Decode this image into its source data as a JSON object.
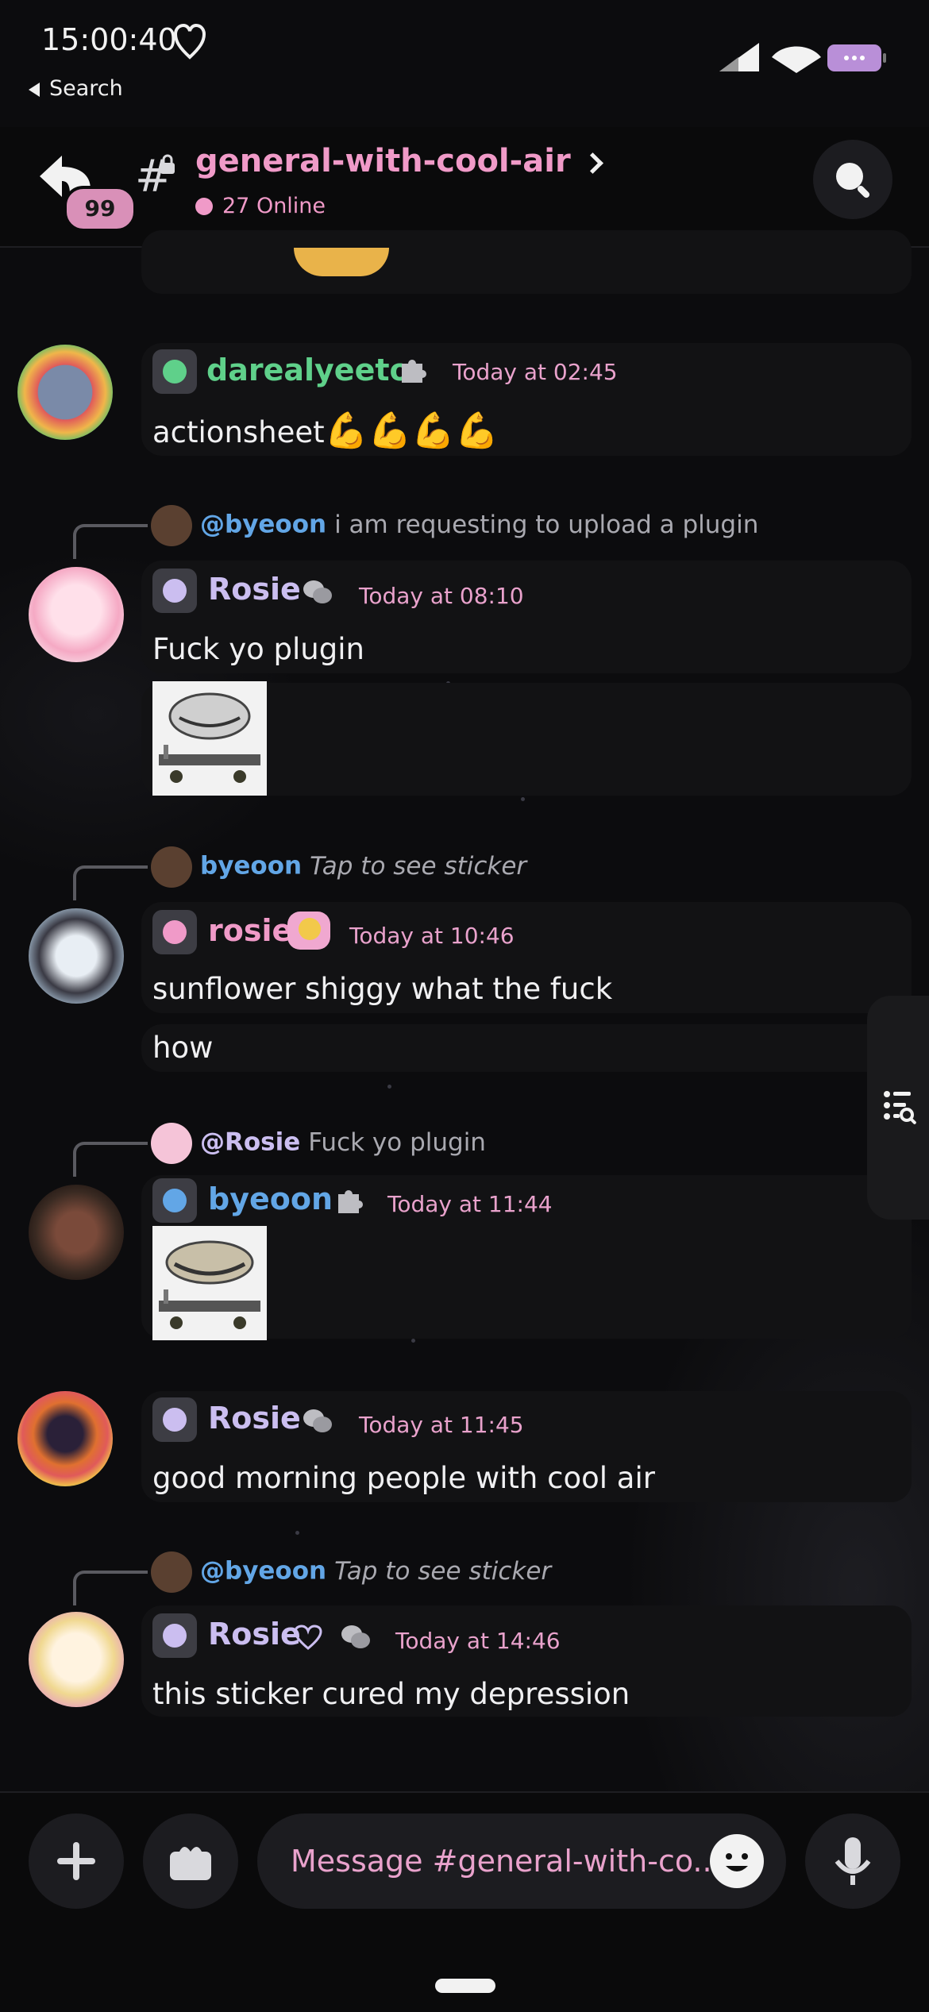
{
  "status_bar": {
    "time": "15:00:40",
    "back_label": "Search"
  },
  "header": {
    "unread_badge": "99",
    "channel_name": "general-with-cool-air",
    "online_text": "27 Online"
  },
  "messages": [
    {
      "author": "darealyeeto",
      "author_color": "#5fd08a",
      "status_color": "#5fd08a",
      "time": "Today at 02:45",
      "text": "actionsheet",
      "emoji": "💪💪💪💪",
      "badge": "puzzle-icon"
    },
    {
      "reply_to": "@byeoon",
      "reply_text": "i am requesting to upload a plugin",
      "author": "Rosie",
      "author_color": "#cbbef0",
      "status_color": "#cbbef0",
      "time": "Today at 08:10",
      "text": "Fuck yo plugin",
      "badge": "chat-bubbles-icon",
      "image": "trollface-cart-image"
    },
    {
      "reply_to": "byeoon",
      "reply_text": "Tap to see sticker",
      "author": "rosie",
      "author_color": "#f09ac8",
      "status_color": "#f09ac8",
      "time": "Today at 10:46",
      "text": "sunflower shiggy what the fuck",
      "text2": "how",
      "badge": "emoji-tag-icon"
    },
    {
      "reply_to": "@Rosie",
      "reply_text": "Fuck yo plugin",
      "author": "byeoon",
      "author_color": "#62a6e6",
      "status_color": "#62a6e6",
      "time": "Today at 11:44",
      "badge": "puzzle-icon",
      "image": "trollface-cart-image"
    },
    {
      "author": "Rosie",
      "author_color": "#cbbef0",
      "status_color": "#cbbef0",
      "time": "Today at 11:45",
      "text": "good morning people with cool air",
      "badge": "chat-bubbles-icon"
    },
    {
      "reply_to": "@byeoon",
      "reply_text": "Tap to see sticker",
      "author": "Rosie",
      "author_color": "#cbbef0",
      "status_color": "#cbbef0",
      "time": "Today at 14:46",
      "text": "this sticker cured my depression",
      "badge": "chat-bubbles-icon"
    }
  ],
  "composer": {
    "placeholder": "Message #general-with-co..."
  },
  "colors": {
    "accent": "#f09ac8",
    "card": "#121214",
    "background": "#0c0c0e"
  }
}
